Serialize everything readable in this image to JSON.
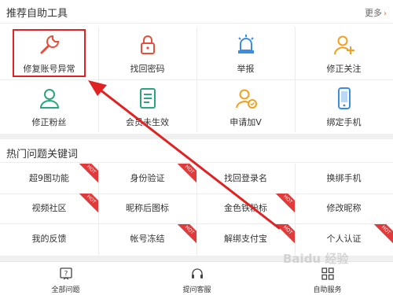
{
  "tools": {
    "title": "推荐自助工具",
    "more_label": "更多",
    "more_chevron": "›",
    "items": [
      {
        "label": "修复账号异常",
        "icon": "wrench-icon",
        "color": "#e94e3c"
      },
      {
        "label": "找回密码",
        "icon": "lock-icon",
        "color": "#e94e3c"
      },
      {
        "label": "举报",
        "icon": "siren-icon",
        "color": "#3a8de0"
      },
      {
        "label": "修正关注",
        "icon": "add-user-icon",
        "color": "#f0a020"
      },
      {
        "label": "修正粉丝",
        "icon": "users-icon",
        "color": "#2aa67a"
      },
      {
        "label": "会员未生效",
        "icon": "document-icon",
        "color": "#2aa67a"
      },
      {
        "label": "申请加V",
        "icon": "verified-user-icon",
        "color": "#f0a020"
      },
      {
        "label": "绑定手机",
        "icon": "phone-icon",
        "color": "#3a8de0"
      }
    ]
  },
  "hot": {
    "title": "热门问题关键词",
    "tag": "HOT",
    "keywords": [
      {
        "label": "超9图功能",
        "hot": true
      },
      {
        "label": "身份验证",
        "hot": true
      },
      {
        "label": "找回登录名",
        "hot": false
      },
      {
        "label": "换绑手机",
        "hot": false
      },
      {
        "label": "视频社区",
        "hot": true
      },
      {
        "label": "昵称后图标",
        "hot": false
      },
      {
        "label": "金色铁粉标",
        "hot": true
      },
      {
        "label": "修改昵称",
        "hot": false
      },
      {
        "label": "我的反馈",
        "hot": false
      },
      {
        "label": "帐号冻结",
        "hot": true
      },
      {
        "label": "解绑支付宝",
        "hot": true
      },
      {
        "label": "个人认证",
        "hot": true
      }
    ]
  },
  "nav": {
    "items": [
      {
        "label": "全部问题",
        "icon": "question-icon"
      },
      {
        "label": "提问客服",
        "icon": "headset-icon"
      },
      {
        "label": "自助服务",
        "icon": "grid-icon"
      }
    ]
  },
  "watermark": "Baidu 经验",
  "colors": {
    "highlight": "#e02222",
    "accent": "#e96b2a",
    "hot_tag": "#e03a3a"
  }
}
